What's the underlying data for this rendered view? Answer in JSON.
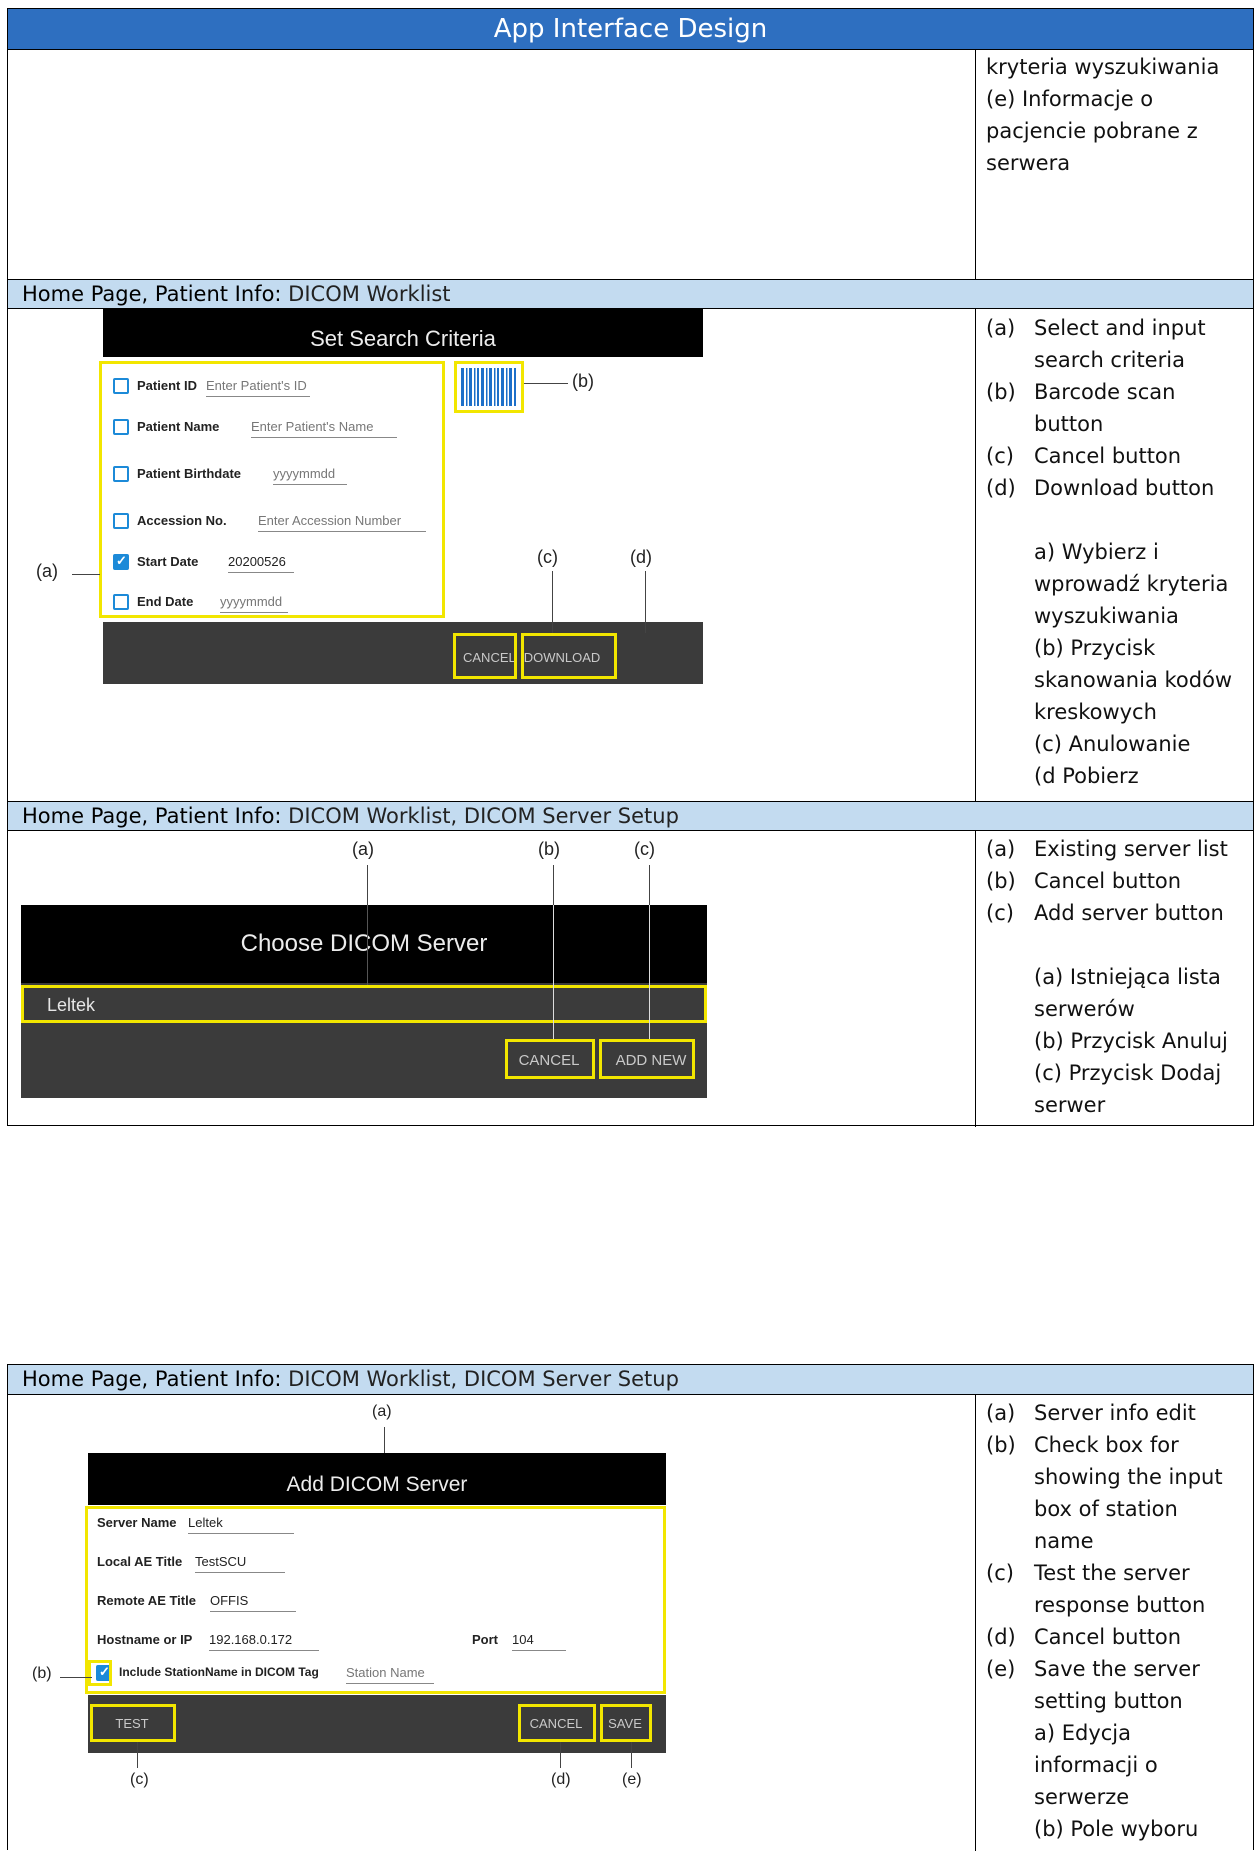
{
  "header": {
    "title": "App Interface Design"
  },
  "top_cell": {
    "lines": [
      "kryteria wyszukiwania",
      "(e) Informacje o pacjencie pobrane z serwera"
    ]
  },
  "sections": [
    {
      "key": "Home Page, Patient Info:",
      "value": " DICOM Worklist"
    },
    {
      "key": "Home Page, Patient Info:",
      "value": " DICOM Worklist, DICOM Server Setup"
    },
    {
      "key": "Home Page, Patient Info:",
      "value": " DICOM Worklist, DICOM Server Setup"
    }
  ],
  "search": {
    "title": "Set Search Criteria",
    "fields": [
      {
        "label": "Patient ID",
        "value": "Enter Patient's ID",
        "checked": false
      },
      {
        "label": "Patient Name",
        "value": "Enter Patient's Name",
        "checked": false
      },
      {
        "label": "Patient Birthdate",
        "value": "yyyymmdd",
        "checked": false
      },
      {
        "label": "Accession No.",
        "value": "Enter Accession Number",
        "checked": false
      },
      {
        "label": "Start Date",
        "value": "20200526",
        "checked": true
      },
      {
        "label": "End Date",
        "value": "yyyymmdd",
        "checked": false
      }
    ],
    "cancel": "CANCEL",
    "download": "DOWNLOAD",
    "ann": {
      "a": "(a)",
      "b": "(b)",
      "c": "(c)",
      "d": "(d)"
    },
    "desc_en": [
      {
        "l": "(a)",
        "t": "Select and input search criteria"
      },
      {
        "l": "(b)",
        "t": "Barcode scan button"
      },
      {
        "l": "(c)",
        "t": "Cancel button"
      },
      {
        "l": "(d)",
        "t": "Download button"
      }
    ],
    "desc_pl": [
      "a) Wybierz i wprowadź kryteria wyszukiwania",
      "(b) Przycisk skanowania kodów kreskowych",
      "(c) Anulowanie",
      "(d Pobierz"
    ]
  },
  "choose": {
    "title": "Choose DICOM Server",
    "server": "Leltek",
    "cancel": "CANCEL",
    "add": "ADD NEW",
    "ann": {
      "a": "(a)",
      "b": "(b)",
      "c": "(c)"
    },
    "desc_en": [
      {
        "l": "(a)",
        "t": "Existing server list"
      },
      {
        "l": "(b)",
        "t": "Cancel button"
      },
      {
        "l": "(c)",
        "t": "Add server button"
      }
    ],
    "desc_pl": [
      "(a) Istniejąca lista serwerów",
      "(b) Przycisk Anuluj",
      "(c) Przycisk Dodaj serwer"
    ]
  },
  "add": {
    "title": "Add DICOM Server",
    "server_name_label": "Server Name",
    "server_name": "Leltek",
    "local_ae_label": "Local AE Title",
    "local_ae": "TestSCU",
    "remote_ae_label": "Remote AE Title",
    "remote_ae": "OFFIS",
    "host_label": "Hostname or IP",
    "host": "192.168.0.172",
    "port_label": "Port",
    "port": "104",
    "station_label": "Include StationName in DICOM Tag",
    "station_placeholder": "Station Name",
    "test": "TEST",
    "cancel": "CANCEL",
    "save": "SAVE",
    "ann": {
      "a": "(a)",
      "b": "(b)",
      "c": "(c)",
      "d": "(d)",
      "e": "(e)"
    },
    "desc_en": [
      {
        "l": "(a)",
        "t": "Server info edit"
      },
      {
        "l": "(b)",
        "t": "Check box for showing the input box of station name"
      },
      {
        "l": "(c)",
        "t": "Test the server response button"
      },
      {
        "l": "(d)",
        "t": "Cancel button"
      },
      {
        "l": "(e)",
        "t": "Save the server setting button"
      }
    ],
    "desc_pl": [
      "a) Edycja informacji o serwerze",
      "(b) Pole wyboru"
    ]
  }
}
